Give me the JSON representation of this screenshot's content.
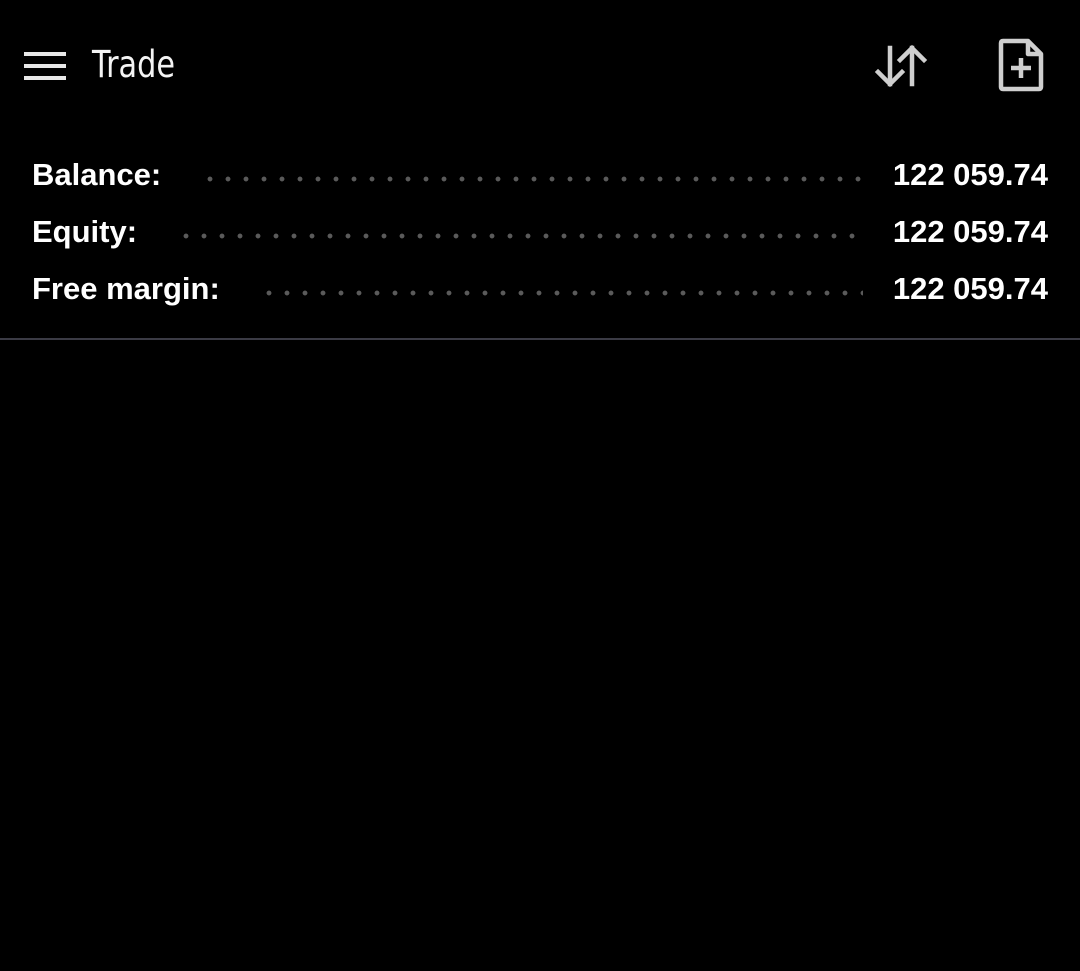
{
  "app_bar": {
    "title": "Trade",
    "menu_icon": "hamburger-menu-icon",
    "sort_icon": "sort-arrows-icon",
    "new_order_icon": "document-plus-icon"
  },
  "account": {
    "rows": [
      {
        "label": "Balance:",
        "value": "122 059.74"
      },
      {
        "label": "Equity:",
        "value": "122 059.74"
      },
      {
        "label": "Free margin:",
        "value": "122 059.74"
      }
    ]
  },
  "colors": {
    "background": "#000000",
    "text": "#ffffff",
    "icon": "#cfcfcf",
    "leader_dots": "#5a5a5a",
    "divider": "#3b3b45"
  }
}
